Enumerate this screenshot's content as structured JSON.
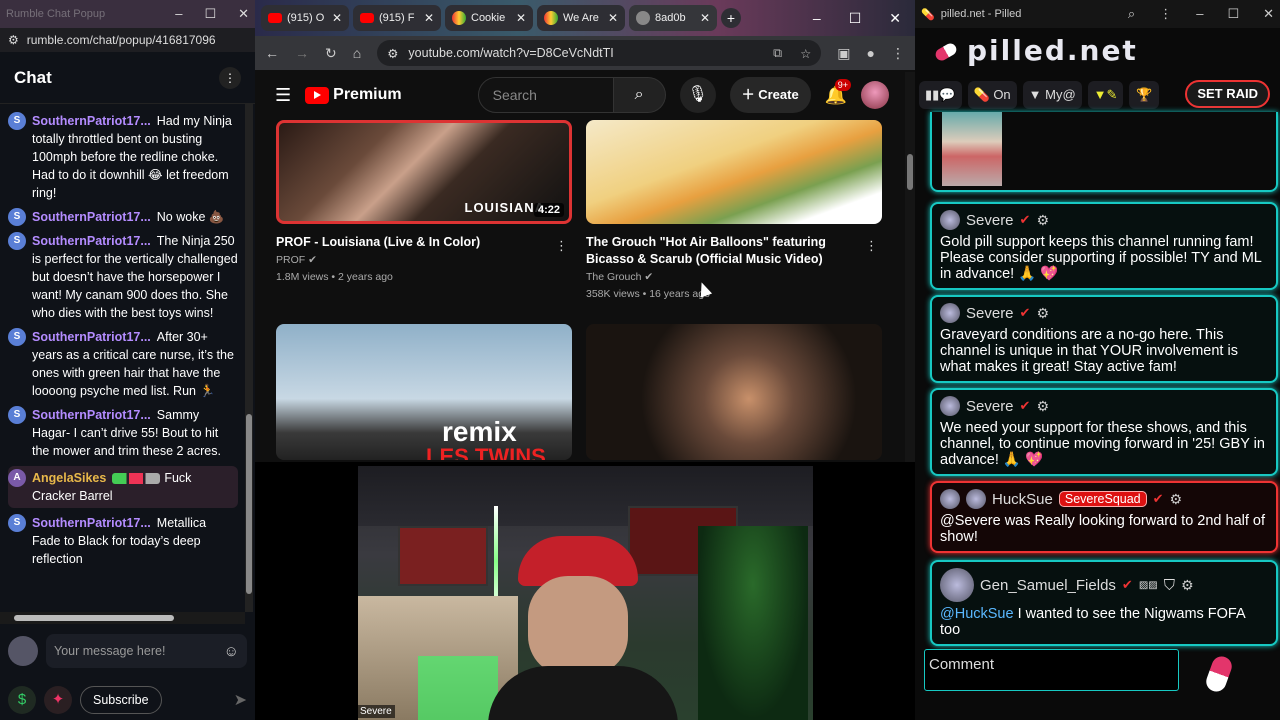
{
  "rumble": {
    "window_title": "Rumble Chat Popup",
    "url": "rumble.com/chat/popup/416817096",
    "chat_title": "Chat",
    "messages": [
      {
        "initial": "S",
        "user": "SouthernPatriot17...",
        "text": "Had my Ninja totally throttled bent on busting 100mph before the redline choke. Had to do it downhill 😂 let freedom ring!"
      },
      {
        "initial": "S",
        "user": "SouthernPatriot17...",
        "text": "No woke 💩"
      },
      {
        "initial": "S",
        "user": "SouthernPatriot17...",
        "text": "The Ninja 250 is perfect for the vertically challenged but doesn’t have the horsepower I want! My canam 900 does tho. She who dies with the best toys wins!"
      },
      {
        "initial": "S",
        "user": "SouthernPatriot17...",
        "text": "After 30+ years as a critical care nurse, it’s the ones with green hair that have the loooong psyche med list. Run 🏃"
      },
      {
        "initial": "S",
        "user": "SouthernPatriot17...",
        "text": "Sammy Hagar- I can’t drive 55! Bout to hit the mower and trim these 2 acres."
      },
      {
        "initial": "A",
        "user": "AngelaSikes",
        "text": "Fuck Cracker Barrel",
        "highlight": true
      },
      {
        "initial": "S",
        "user": "SouthernPatriot17...",
        "text": "Metallica Fade to Black for today’s deep reflection"
      }
    ],
    "input_placeholder": "Your message here!",
    "subscribe_label": "Subscribe"
  },
  "browser": {
    "tabs": [
      {
        "label": "(915) O",
        "icon": "youtube-icon"
      },
      {
        "label": "(915) F",
        "icon": "youtube-icon"
      },
      {
        "label": "Cookie",
        "icon": "chrome-icon"
      },
      {
        "label": "We Are",
        "icon": "chrome-icon"
      },
      {
        "label": "8ad0b",
        "icon": "globe-icon",
        "active": true
      }
    ],
    "url": "youtube.com/watch?v=D8CeVcNdtTI"
  },
  "youtube": {
    "logo_text": "Premium",
    "search_placeholder": "Search",
    "create_label": "Create",
    "notif_count": "9+",
    "videos": [
      {
        "title": "PROF - Louisiana (Live & In Color)",
        "channel": "PROF",
        "meta": "1.8M views • 2 years ago",
        "duration": "4:22",
        "overlay": "LOUISIANA"
      },
      {
        "title": "The Grouch \"Hot Air Balloons\" featuring Bicasso & Scarub (Official Music Video)",
        "channel": "The Grouch",
        "meta": "358K views • 16 years ago"
      },
      {
        "overlay": "remix",
        "overlay2": "LES TWINS"
      },
      {}
    ]
  },
  "webcam": {
    "name_label": "Severe"
  },
  "pilled": {
    "window_title": "pilled.net - Pilled",
    "logo": "pilled.net",
    "toolbar": {
      "on_label": "On",
      "my_label": "My@",
      "raid_label": "SET RAID"
    },
    "messages": [
      {
        "user": "Severe",
        "text": "Gold pill support keeps this channel running fam! Please consider supporting if possible! TY and ML in advance! 🙏 💖"
      },
      {
        "user": "Severe",
        "text": "Graveyard conditions are a no-go here. This channel is unique in that YOUR involvement is what makes it great! Stay active fam!"
      },
      {
        "user": "Severe",
        "text": "We need your support for these shows, and this channel, to continue moving forward in '25! GBY in advance! 🙏 💖"
      },
      {
        "user": "HuckSue",
        "badge": "SevereSquad",
        "text": "@Severe was Really looking forward to 2nd half of show!"
      },
      {
        "user": "Gen_Samuel_Fields",
        "mention": "@HuckSue",
        "text": "I wanted to see the Nigwams FOFA too"
      }
    ],
    "comment_placeholder": "Comment"
  }
}
